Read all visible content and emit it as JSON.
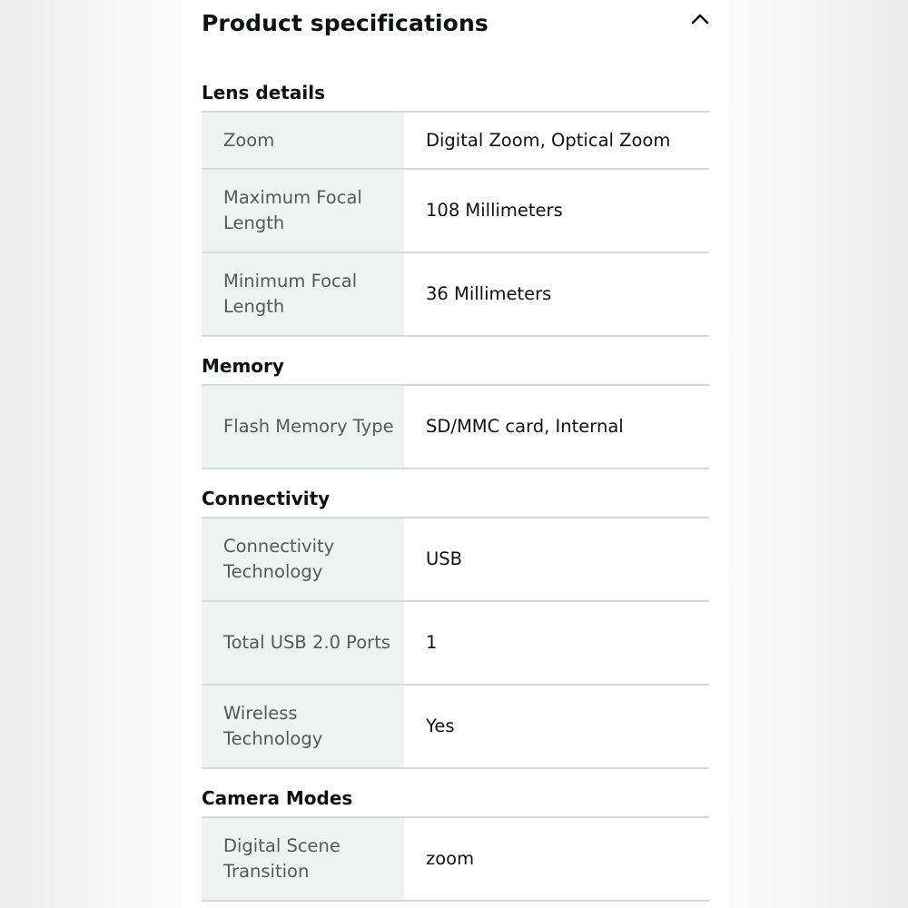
{
  "header": {
    "title": "Product specifications",
    "collapse_icon": "chevron-up-icon"
  },
  "sections": [
    {
      "title": "Lens details",
      "rows": [
        {
          "key": "Zoom",
          "value": "Digital Zoom, Optical Zoom"
        },
        {
          "key": "Maximum Focal Length",
          "value": "108 Millimeters"
        },
        {
          "key": "Minimum Focal Length",
          "value": "36 Millimeters"
        }
      ]
    },
    {
      "title": "Memory",
      "rows": [
        {
          "key": "Flash Memory Type",
          "value": "SD/MMC card, Internal"
        }
      ]
    },
    {
      "title": "Connectivity",
      "rows": [
        {
          "key": "Connectivity Technology",
          "value": "USB"
        },
        {
          "key": "Total USB 2.0 Ports",
          "value": "1"
        },
        {
          "key": "Wireless Technology",
          "value": "Yes"
        }
      ]
    },
    {
      "title": "Camera Modes",
      "rows": [
        {
          "key": "Digital Scene Transition",
          "value": "zoom"
        }
      ]
    }
  ],
  "colors": {
    "key_background": "#f0f2f2",
    "key_text": "#565959",
    "value_text": "#0f1111",
    "row_border": "#d5d9d9"
  }
}
